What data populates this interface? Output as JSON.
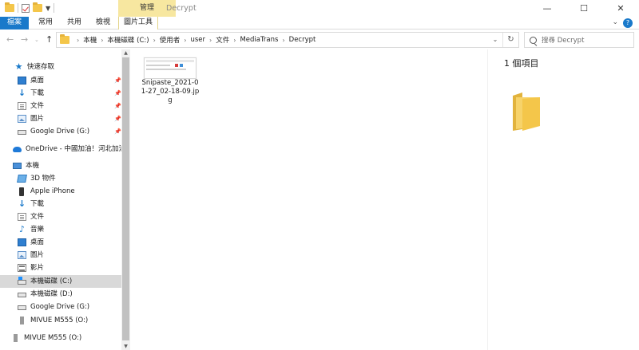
{
  "window": {
    "title": "Decrypt",
    "tool_context_label": "管理",
    "min": "—",
    "max": "☐",
    "close": "✕"
  },
  "ribbon": {
    "tabs": [
      {
        "label": "檔案"
      },
      {
        "label": "常用"
      },
      {
        "label": "共用"
      },
      {
        "label": "檢視"
      },
      {
        "label": "圖片工具"
      }
    ],
    "help": "?"
  },
  "address": {
    "crumbs": [
      "本機",
      "本機磁碟 (C:)",
      "使用者",
      "user",
      "文件",
      "MediaTrans",
      "Decrypt"
    ]
  },
  "search": {
    "placeholder": "搜尋 Decrypt"
  },
  "nav": {
    "quick_access": "快速存取",
    "quick_items": [
      {
        "label": "桌面",
        "icon": "desktop-icon"
      },
      {
        "label": "下載",
        "icon": "download-icon"
      },
      {
        "label": "文件",
        "icon": "documents-icon"
      },
      {
        "label": "圖片",
        "icon": "pictures-icon"
      },
      {
        "label": "Google Drive (G:)",
        "icon": "drive-icon"
      }
    ],
    "onedrive": "OneDrive - 中國加油！河北加油！",
    "this_pc": "本機",
    "pc_items": [
      {
        "label": "3D 物件",
        "icon": "3d-objects-icon"
      },
      {
        "label": "Apple iPhone",
        "icon": "phone-icon"
      },
      {
        "label": "下載",
        "icon": "download-icon"
      },
      {
        "label": "文件",
        "icon": "documents-icon"
      },
      {
        "label": "音樂",
        "icon": "music-icon"
      },
      {
        "label": "桌面",
        "icon": "desktop-icon"
      },
      {
        "label": "圖片",
        "icon": "pictures-icon"
      },
      {
        "label": "影片",
        "icon": "videos-icon"
      },
      {
        "label": "本機磁碟 (C:)",
        "icon": "windows-drive-icon"
      },
      {
        "label": "本機磁碟 (D:)",
        "icon": "drive-icon"
      },
      {
        "label": "Google Drive (G:)",
        "icon": "drive-icon"
      },
      {
        "label": "MIVUE M555 (O:)",
        "icon": "usb-drive-icon"
      }
    ],
    "bottom_item": "MIVUE M555 (O:)"
  },
  "content": {
    "files": [
      {
        "name": "Snipaste_2021-01-27_02-18-09.jpg"
      }
    ]
  },
  "details": {
    "count": "1 個項目"
  }
}
